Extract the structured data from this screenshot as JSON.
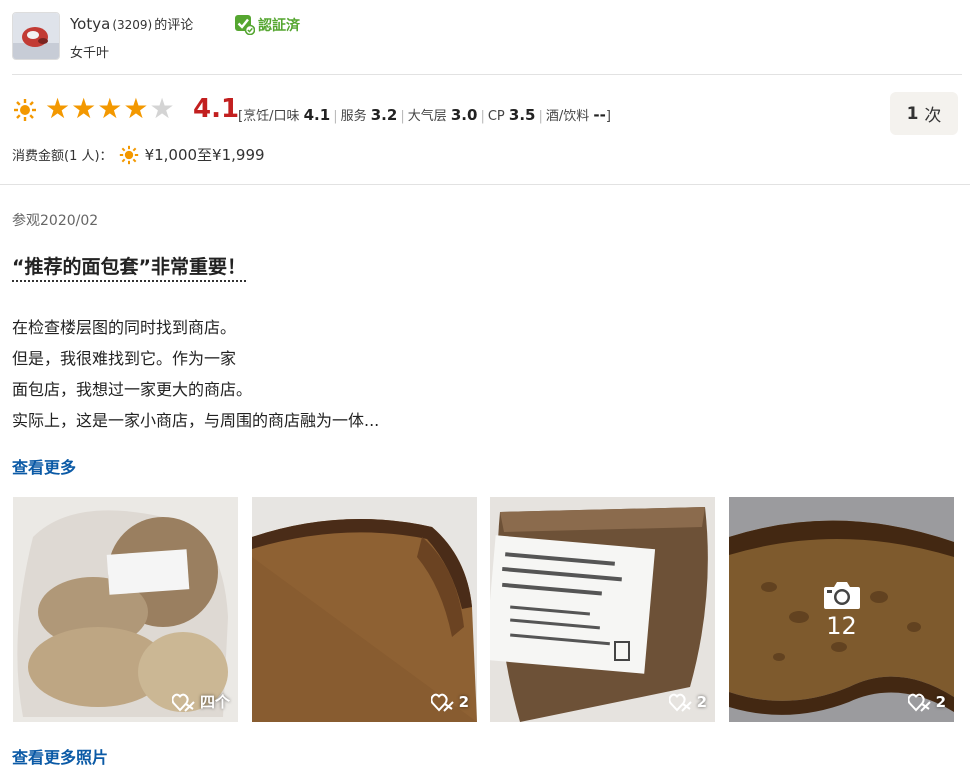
{
  "reviewer": {
    "name": "Yotya",
    "review_count": "(3209)",
    "name_suffix": "的评论",
    "verified_label": "認証済",
    "profile": "女千叶"
  },
  "rating": {
    "stars_filled": 4,
    "stars_total": 5,
    "score": "4.1",
    "open_bracket": "[",
    "close_bracket": "]",
    "subscores": [
      {
        "label": "烹饪/口味",
        "value": "4.1"
      },
      {
        "label": "服务",
        "value": "3.2"
      },
      {
        "label": "大气层",
        "value": "3.0"
      },
      {
        "label": "CP",
        "value": "3.5"
      },
      {
        "label": "酒/饮料",
        "value": "--"
      }
    ],
    "visits_count": "1",
    "visits_unit": "次",
    "spend_label": "消费金额(1 人)：",
    "spend_value": "¥1,000至¥1,999"
  },
  "review": {
    "visited": "参观2020/02",
    "title": "“推荐的面包套”非常重要！",
    "body_lines": [
      "在检查楼层图的同时找到商店。",
      "但是，我很难找到它。作为一家",
      "面包店，我想过一家更大的商店。",
      "实际上，这是一家小商店，与周围的商店融为一体..."
    ],
    "more_label": "查看更多",
    "photos": [
      {
        "likes": "四个"
      },
      {
        "likes": "2"
      },
      {
        "likes": "2"
      },
      {
        "likes": "2",
        "total_photos": "12"
      }
    ],
    "more_photos_label": "查看更多照片"
  },
  "colors": {
    "star": "#f39800",
    "score": "#c21f1f",
    "link": "#0b5aa6",
    "verified": "#55a630"
  }
}
